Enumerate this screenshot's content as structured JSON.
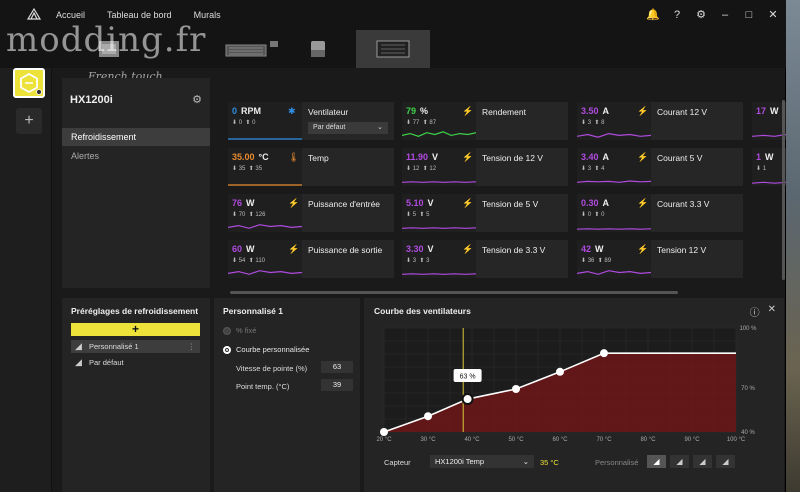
{
  "watermark": {
    "text": "modding.fr",
    "sub": "French touch"
  },
  "nav": [
    "Accueil",
    "Tableau de bord",
    "Murals"
  ],
  "window_icons": [
    "bell-icon",
    "help-icon",
    "gear-icon",
    "minimize-icon",
    "maximize-icon",
    "close-icon"
  ],
  "device": {
    "name": "HX1200i"
  },
  "device_menu": [
    "Refroidissement",
    "Alertes"
  ],
  "tiles": [
    {
      "value": "0",
      "unit": "RPM",
      "min": "0",
      "max": "0",
      "label": "Ventilateur",
      "select": "Par défaut",
      "icon": "fan-icon",
      "color": "#2f8fe6",
      "spark": [
        0,
        0,
        0,
        0,
        0,
        0,
        0,
        0
      ]
    },
    {
      "value": "79",
      "unit": "%",
      "min": "77",
      "max": "87",
      "label": "Rendement",
      "icon": "bolt-icon",
      "color": "#3fd34b",
      "spark": [
        0.4,
        0.6,
        0.3,
        0.7,
        0.5,
        0.8,
        0.4,
        0.6,
        0.5,
        0.7
      ]
    },
    {
      "value": "3.50",
      "unit": "A",
      "min": "3",
      "max": "8",
      "label": "Courant 12 V",
      "icon": "bolt-icon",
      "color": "#b04be0",
      "spark": [
        0.3,
        0.5,
        0.2,
        0.6,
        0.4,
        0.5,
        0.3,
        0.4
      ]
    },
    {
      "value": "17",
      "unit": "W",
      "min": "",
      "max": "",
      "label": "",
      "icon": "",
      "color": "#b04be0",
      "spark": [
        0.3,
        0.4,
        0.3,
        0.5
      ]
    },
    {
      "value": "35.00",
      "unit": "°C",
      "min": "35",
      "max": "35",
      "label": "Temp",
      "icon": "thermometer-icon",
      "color": "#e68a2f",
      "spark": [
        0,
        0,
        0,
        0,
        0,
        0,
        0,
        0
      ]
    },
    {
      "value": "11.90",
      "unit": "V",
      "min": "12",
      "max": "12",
      "label": "Tension de 12 V",
      "icon": "bolt-icon",
      "color": "#b04be0",
      "spark": [
        0.3,
        0.35,
        0.3,
        0.35,
        0.3,
        0.35,
        0.3,
        0.35
      ]
    },
    {
      "value": "3.40",
      "unit": "A",
      "min": "3",
      "max": "4",
      "label": "Courant 5 V",
      "icon": "bolt-icon",
      "color": "#b04be0",
      "spark": [
        0.3,
        0.4,
        0.35,
        0.4,
        0.3,
        0.45,
        0.35,
        0.4
      ]
    },
    {
      "value": "1",
      "unit": "W",
      "min": "1",
      "max": "",
      "label": "",
      "icon": "",
      "color": "#b04be0",
      "spark": [
        0.2,
        0.3,
        0.2,
        0.3
      ]
    },
    {
      "value": "76",
      "unit": "W",
      "min": "70",
      "max": "126",
      "label": "Puissance d'entrée",
      "icon": "bolt-icon",
      "color": "#b04be0",
      "spark": [
        0.4,
        0.6,
        0.3,
        0.7,
        0.5,
        0.6,
        0.4,
        0.5
      ]
    },
    {
      "value": "5.10",
      "unit": "V",
      "min": "5",
      "max": "5",
      "label": "Tension de 5 V",
      "icon": "bolt-icon",
      "color": "#b04be0",
      "spark": [
        0.3,
        0.35,
        0.3,
        0.35,
        0.3,
        0.35,
        0.3,
        0.35
      ]
    },
    {
      "value": "0.30",
      "unit": "A",
      "min": "0",
      "max": "0",
      "label": "Courant 3.3 V",
      "icon": "bolt-icon",
      "color": "#b04be0",
      "spark": [
        0.2,
        0.25,
        0.2,
        0.25,
        0.2,
        0.25,
        0.2,
        0.25
      ]
    },
    {
      "value": "60",
      "unit": "W",
      "min": "54",
      "max": "110",
      "label": "Puissance de sortie",
      "icon": "bolt-icon",
      "color": "#b04be0",
      "spark": [
        0.4,
        0.6,
        0.3,
        0.7,
        0.5,
        0.6,
        0.4,
        0.5
      ]
    },
    {
      "value": "3.30",
      "unit": "V",
      "min": "3",
      "max": "3",
      "label": "Tension de 3.3 V",
      "icon": "bolt-icon",
      "color": "#b04be0",
      "spark": [
        0.3,
        0.35,
        0.3,
        0.35,
        0.3,
        0.35,
        0.3,
        0.35
      ]
    },
    {
      "value": "42",
      "unit": "W",
      "min": "36",
      "max": "89",
      "label": "Tension 12 V",
      "icon": "bolt-icon",
      "color": "#b04be0",
      "spark": [
        0.4,
        0.6,
        0.3,
        0.7,
        0.5,
        0.6,
        0.4,
        0.5
      ]
    }
  ],
  "presets": {
    "title": "Préréglages de refroidissement",
    "add_label": "+",
    "items": [
      "Personnalisé 1",
      "Par défaut"
    ]
  },
  "custom": {
    "title": "Personnalisé 1",
    "fixed_label": "% fixé",
    "curve_label": "Courbe personnalisée",
    "peak_label": "Vitesse de pointe (%)",
    "peak_value": "63",
    "temp_label": "Point temp. (°C)",
    "temp_value": "39"
  },
  "curve_panel": {
    "title": "Courbe des ventilateurs",
    "sensor_label": "Capteur",
    "sensor_value": "HX1200i Temp",
    "sensor_reading": "35 °C",
    "mode_label": "Personnalisé",
    "tooltip": "63 %"
  },
  "chart_data": {
    "type": "line",
    "title": "Courbe des ventilateurs",
    "xlabel": "",
    "ylabel": "",
    "x_ticks": [
      "20 °C",
      "30 °C",
      "40 °C",
      "50 °C",
      "60 °C",
      "70 °C",
      "80 °C",
      "90 °C",
      "100 °C"
    ],
    "y_ticks": [
      "100 %",
      "70 %",
      "40 %"
    ],
    "xlim": [
      20,
      100
    ],
    "ylim": [
      40,
      100
    ],
    "points": [
      {
        "x": 20,
        "y": 40
      },
      {
        "x": 30,
        "y": 51
      },
      {
        "x": 39,
        "y": 63
      },
      {
        "x": 50,
        "y": 70
      },
      {
        "x": 60,
        "y": 82
      },
      {
        "x": 70,
        "y": 95
      },
      {
        "x": 100,
        "y": 95
      }
    ],
    "current_temp": 35,
    "selected_index": 2
  }
}
